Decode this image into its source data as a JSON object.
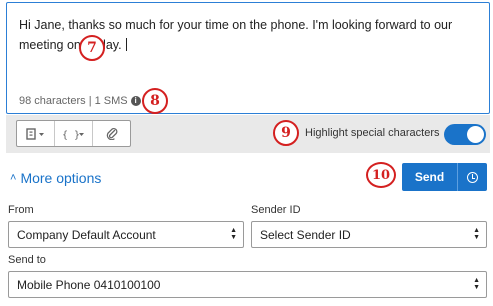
{
  "compose": {
    "message": "Hi Jane, thanks so much for your time on the phone. I'm looking forward to our meeting on Friday. ",
    "counter": "98 characters | 1 SMS"
  },
  "badges": {
    "b7": "7",
    "b8": "8",
    "b9": "9",
    "b10": "10"
  },
  "toolbar": {
    "highlight_label": "Highlight special characters",
    "highlight_enabled": true,
    "tools": [
      {
        "icon": "template-icon"
      },
      {
        "icon": "insert-field-icon"
      },
      {
        "icon": "attachment-icon"
      }
    ]
  },
  "options": {
    "more_options_label": "More options"
  },
  "send": {
    "label": "Send"
  },
  "form": {
    "from_label": "From",
    "from_value": "Company Default Account",
    "sender_id_label": "Sender ID",
    "sender_id_value": "Select Sender ID",
    "send_to_label": "Send to",
    "send_to_value": "Mobile Phone 0410100100"
  },
  "colors": {
    "accent": "#1a73c9",
    "badge": "#d42020",
    "toolbar_bg": "#e9e9e9"
  }
}
